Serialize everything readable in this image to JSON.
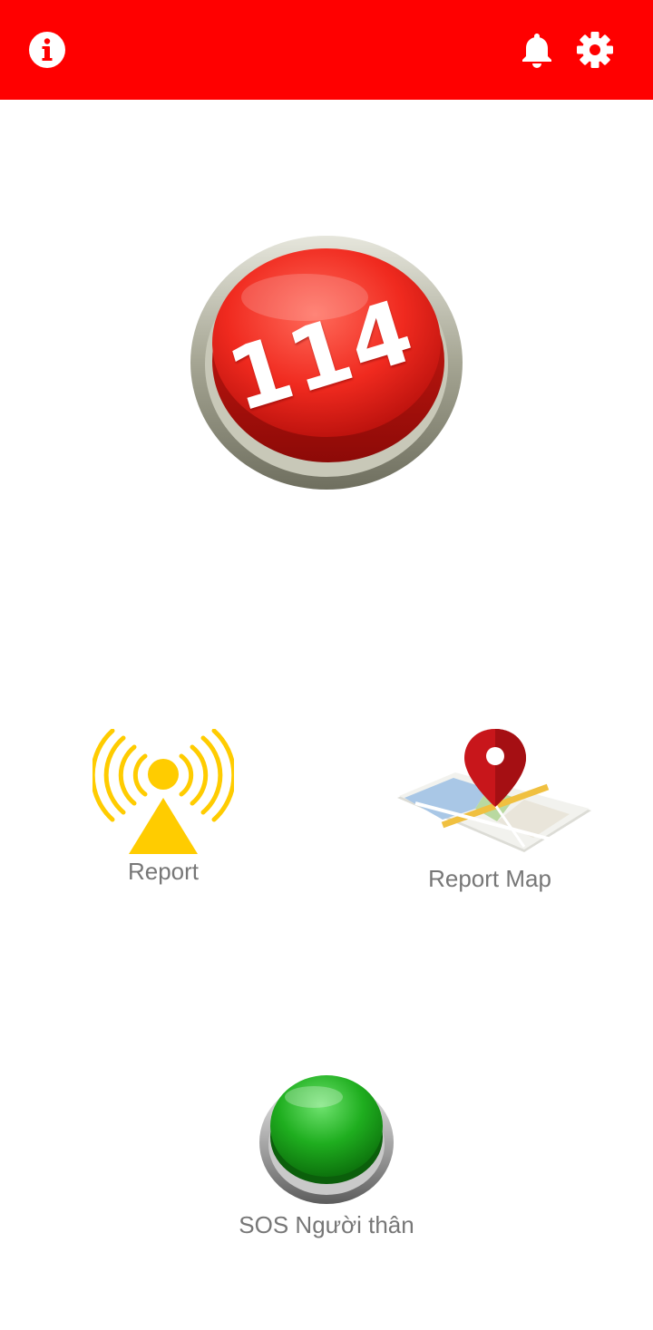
{
  "header": {
    "background_color": "#ff0000",
    "left_icon": "info-icon",
    "right_icons": [
      "bell-icon",
      "gear-icon"
    ]
  },
  "emergency_button": {
    "label": "114",
    "color": "#ff2a2a",
    "icon": "red-push-button"
  },
  "report": {
    "label": "Report",
    "icon": "signal-tower-icon",
    "color": "#ffcc00"
  },
  "report_map": {
    "label": "Report Map",
    "icon": "map-pin-icon"
  },
  "sos": {
    "label": "SOS Người thân",
    "icon": "green-push-button",
    "color": "#1fae1f"
  }
}
